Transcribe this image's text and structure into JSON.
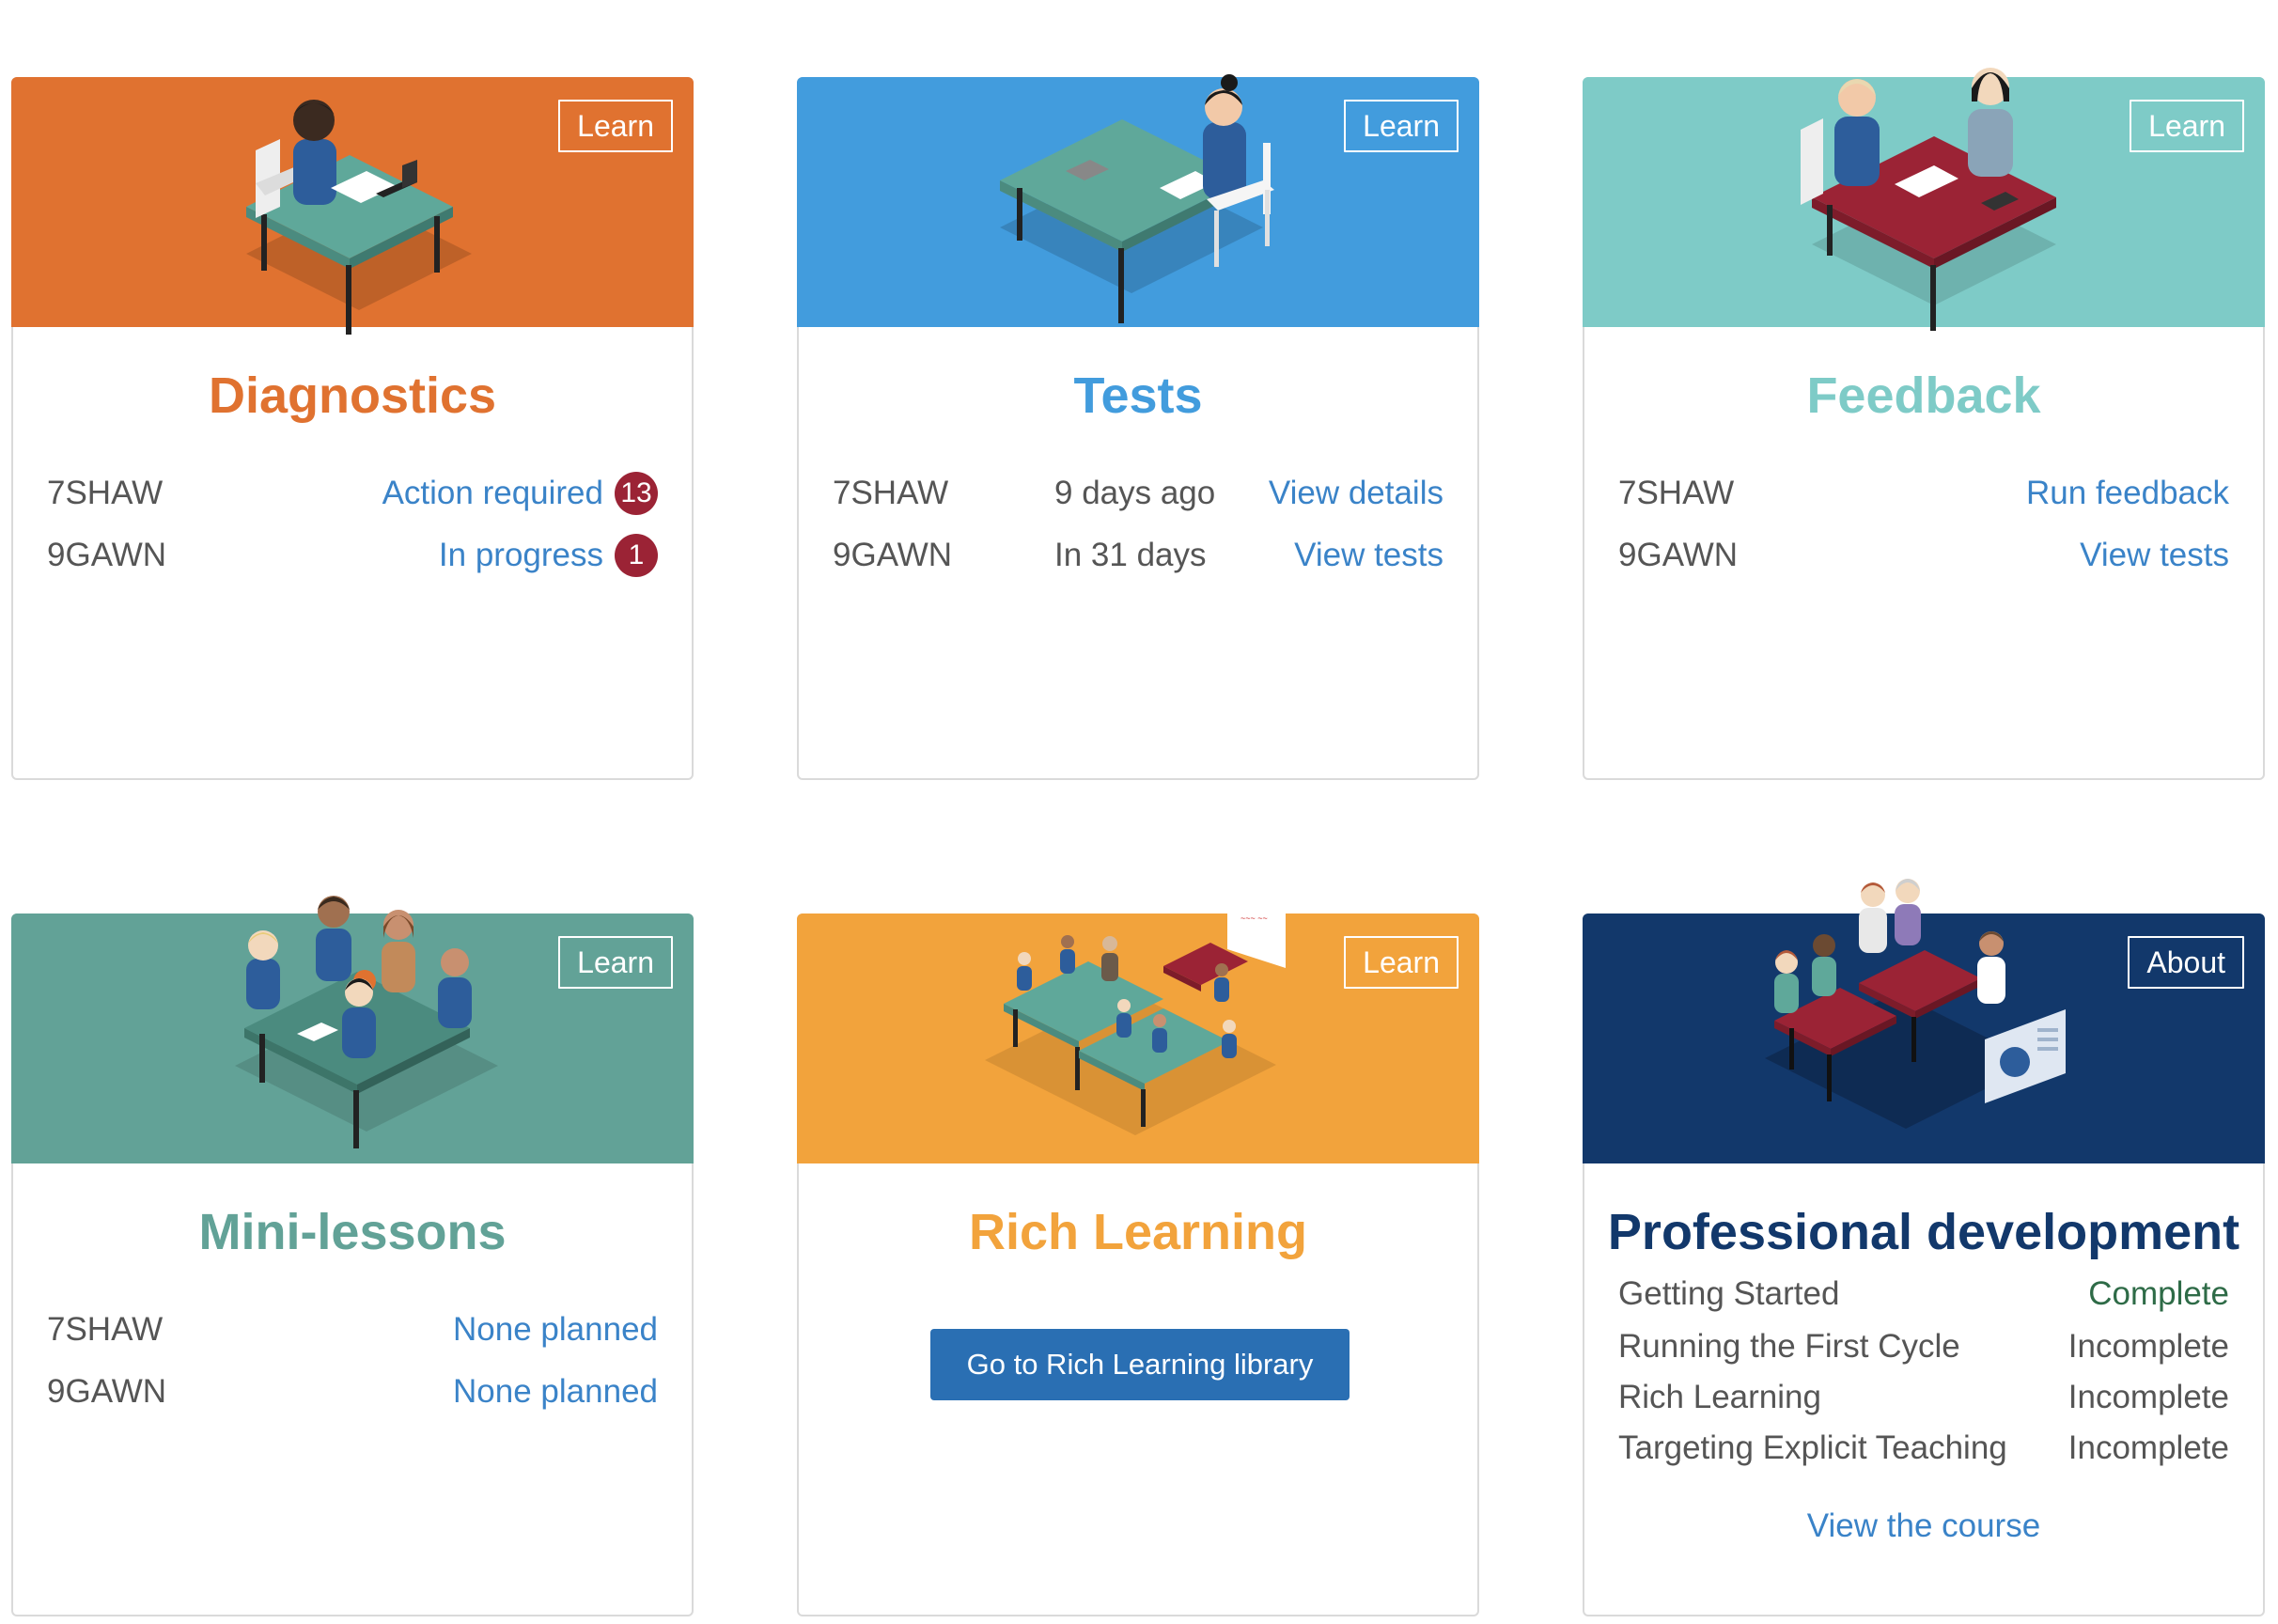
{
  "colors": {
    "diagnostics": "#e07230",
    "tests": "#429cdd",
    "feedback": "#7ecbc7",
    "mini_lessons": "#62a297",
    "rich_learning": "#f2a33c",
    "professional_development": "#12386b",
    "link": "#3a83c8",
    "badge": "#9b2335",
    "primary_button": "#2a6fb3",
    "complete": "#2e6b47"
  },
  "diagnostics": {
    "title": "Diagnostics",
    "learn_label": "Learn",
    "illustration_icon": "teacher-at-desk-illustration",
    "rows": [
      {
        "class_name": "7SHAW",
        "status": "Action required",
        "badge": "13"
      },
      {
        "class_name": "9GAWN",
        "status": "In progress",
        "badge": "1"
      }
    ]
  },
  "tests": {
    "title": "Tests",
    "learn_label": "Learn",
    "illustration_icon": "student-taking-test-illustration",
    "rows": [
      {
        "class_name": "7SHAW",
        "when": "9 days ago",
        "action": "View details"
      },
      {
        "class_name": "9GAWN",
        "when": "In 31 days",
        "action": "View tests"
      }
    ]
  },
  "feedback": {
    "title": "Feedback",
    "learn_label": "Learn",
    "illustration_icon": "teacher-student-feedback-illustration",
    "rows": [
      {
        "class_name": "7SHAW",
        "action": "Run feedback"
      },
      {
        "class_name": "9GAWN",
        "action": "View tests"
      }
    ]
  },
  "mini_lessons": {
    "title": "Mini-lessons",
    "learn_label": "Learn",
    "illustration_icon": "group-lesson-illustration",
    "rows": [
      {
        "class_name": "7SHAW",
        "action": "None planned"
      },
      {
        "class_name": "9GAWN",
        "action": "None planned"
      }
    ]
  },
  "rich_learning": {
    "title": "Rich Learning",
    "learn_label": "Learn",
    "illustration_icon": "classroom-illustration",
    "button_label": "Go to Rich Learning library"
  },
  "professional_development": {
    "title": "Professional development",
    "about_label": "About",
    "illustration_icon": "staff-meeting-illustration",
    "modules": [
      {
        "name": "Getting Started",
        "status": "Complete"
      },
      {
        "name": "Running the First Cycle",
        "status": "Incomplete"
      },
      {
        "name": "Rich Learning",
        "status": "Incomplete"
      },
      {
        "name": "Targeting Explicit Teaching",
        "status": "Incomplete"
      }
    ],
    "course_link": "View the course"
  }
}
